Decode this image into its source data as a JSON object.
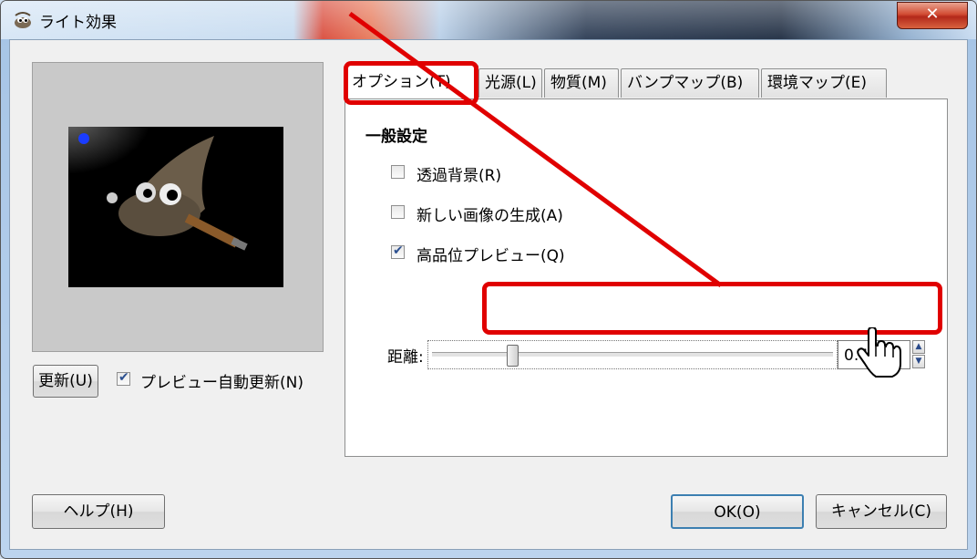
{
  "window": {
    "title": "ライト効果",
    "close_glyph": "✕"
  },
  "preview": {
    "update_button": "更新(U)",
    "auto_update_label": "プレビュー自動更新(N)",
    "auto_update_checked": true
  },
  "tabs": [
    {
      "label": "オプション(T)",
      "active": true
    },
    {
      "label": "光源(L)",
      "active": false
    },
    {
      "label": "物質(M)",
      "active": false
    },
    {
      "label": "バンプマップ(B)",
      "active": false
    },
    {
      "label": "環境マップ(E)",
      "active": false
    }
  ],
  "options": {
    "section_title": "一般設定",
    "transparent_bg": {
      "label": "透過背景(R)",
      "checked": false
    },
    "new_image": {
      "label": "新しい画像の生成(A)",
      "checked": false
    },
    "hq_preview": {
      "label": "高品位プレビュー(Q)",
      "checked": true
    },
    "distance": {
      "label": "距離:",
      "value": "0.400",
      "fraction": 0.2
    }
  },
  "footer": {
    "help": "ヘルプ(H)",
    "ok": "OK(O)",
    "cancel": "キャンセル(C)"
  },
  "annotation": {
    "color": "#e00000"
  },
  "icons": {
    "app": "gimp-wilber-icon",
    "cursor": "hand-pointer-icon"
  }
}
